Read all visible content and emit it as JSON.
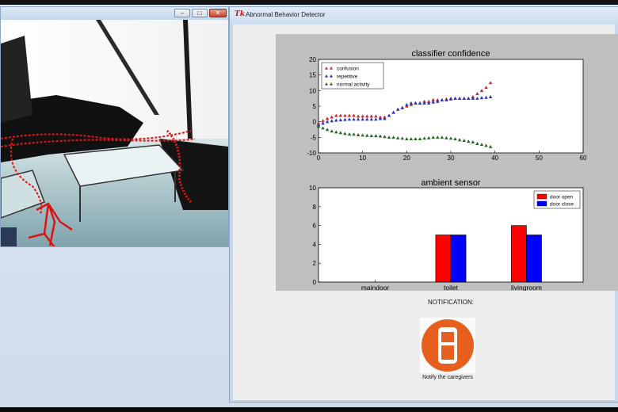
{
  "windows": {
    "right": {
      "app_icon": "Tk",
      "title": "Abnormal Behavior Detector"
    }
  },
  "notification": {
    "label": "NOTIFICATION:",
    "button_label": "Notify the caregivers",
    "icon": "mobile-phone-icon",
    "color": "#e65f1f"
  },
  "chart_data": [
    {
      "type": "scatter",
      "title": "classifier confidence",
      "xlim": [
        0,
        60
      ],
      "ylim": [
        -10,
        20
      ],
      "xticks": [
        0,
        10,
        20,
        30,
        40,
        50,
        60
      ],
      "yticks": [
        -10,
        -5,
        0,
        5,
        10,
        15,
        20
      ],
      "legend": "top-left",
      "x": [
        0,
        1,
        2,
        3,
        4,
        5,
        6,
        7,
        8,
        9,
        10,
        11,
        12,
        13,
        14,
        15,
        16,
        17,
        18,
        19,
        20,
        21,
        22,
        23,
        24,
        25,
        26,
        27,
        28,
        29,
        30,
        31,
        32,
        33,
        34,
        35,
        36,
        37,
        38,
        39
      ],
      "series": [
        {
          "name": "confusion",
          "color": "#cc2222",
          "values": [
            -0.5,
            0.3,
            1,
            1.5,
            2,
            2,
            2,
            2,
            2,
            1.8,
            1.8,
            1.8,
            1.8,
            1.8,
            1.5,
            1.5,
            2,
            3,
            4,
            4.5,
            5,
            5.5,
            6,
            6,
            6.5,
            6.5,
            7,
            7,
            7,
            7.3,
            7.5,
            7.5,
            7.5,
            7.5,
            7.5,
            8,
            9,
            10,
            11,
            12.5
          ]
        },
        {
          "name": "repetitive",
          "color": "#2233cc",
          "values": [
            -1,
            -0.5,
            0,
            0.3,
            0.5,
            0.6,
            0.7,
            0.8,
            0.8,
            0.8,
            0.8,
            0.8,
            0.8,
            0.8,
            1,
            1,
            2,
            3,
            4,
            4.5,
            5.5,
            6,
            6,
            6,
            6,
            6,
            6.3,
            6.5,
            7,
            7,
            7.3,
            7.5,
            7.5,
            7.5,
            7.5,
            7.5,
            7.5,
            7.7,
            7.8,
            8
          ]
        },
        {
          "name": "normal activity",
          "color": "#226622",
          "values": [
            -1.5,
            -2,
            -2.5,
            -3,
            -3.3,
            -3.5,
            -3.8,
            -4,
            -4,
            -4.2,
            -4.3,
            -4.4,
            -4.5,
            -4.5,
            -4.6,
            -4.8,
            -5,
            -5,
            -5.2,
            -5.3,
            -5.5,
            -5.5,
            -5.5,
            -5.5,
            -5.3,
            -5.2,
            -5,
            -5,
            -5,
            -5.2,
            -5.3,
            -5.5,
            -5.8,
            -6,
            -6.3,
            -6.5,
            -7,
            -7.3,
            -7.6,
            -8
          ]
        }
      ]
    },
    {
      "type": "bar",
      "title": "ambient sensor",
      "categories": [
        "maindoor",
        "toilet",
        "livingroom"
      ],
      "ylim": [
        0,
        10
      ],
      "yticks": [
        0,
        2,
        4,
        6,
        8,
        10
      ],
      "legend": "top-right",
      "series": [
        {
          "name": "door open",
          "color": "#ff0000",
          "values": [
            0,
            5,
            6
          ]
        },
        {
          "name": "door close",
          "color": "#0000ff",
          "values": [
            0,
            5,
            5
          ]
        }
      ]
    }
  ]
}
